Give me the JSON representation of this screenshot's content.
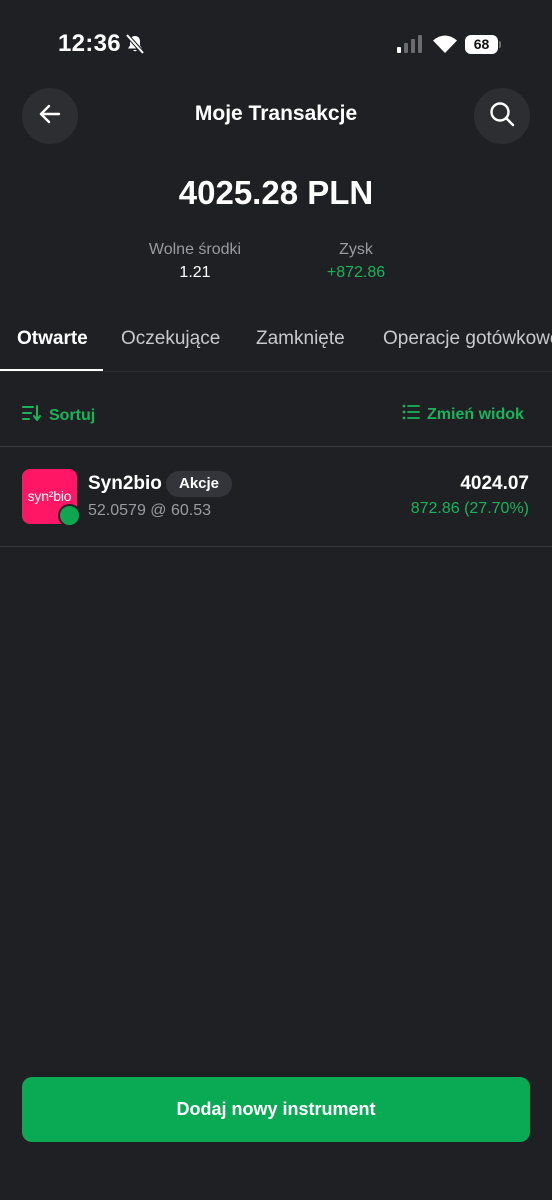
{
  "status_bar": {
    "time": "12:36",
    "battery": "68",
    "icons": [
      "bell-muted-icon",
      "signal-icon",
      "wifi-icon",
      "battery-icon"
    ]
  },
  "header": {
    "title": "Moje Transakcje",
    "back_icon": "arrow-left-icon",
    "search_icon": "search-icon"
  },
  "summary": {
    "total": "4025.28 PLN",
    "free_funds_label": "Wolne środki",
    "free_funds_value": "1.21",
    "profit_label": "Zysk",
    "profit_value": "+872.86"
  },
  "tabs": [
    {
      "label": "Otwarte",
      "active": true
    },
    {
      "label": "Oczekujące",
      "active": false
    },
    {
      "label": "Zamknięte",
      "active": false
    },
    {
      "label": "Operacje gotówkowe",
      "active": false
    }
  ],
  "toolbar": {
    "sort_label": "Sortuj",
    "view_label": "Zmień widok",
    "sort_icon": "sort-icon",
    "view_icon": "list-view-icon"
  },
  "positions": [
    {
      "logo_text": "syn²bio",
      "name": "Syn2bio",
      "badge": "Akcje",
      "details": "52.0579 @ 60.53",
      "value": "4024.07",
      "pl": "872.86 (27.70%)",
      "market_status": "open"
    }
  ],
  "actions": {
    "add_instrument": "Dodaj nowy instrument"
  },
  "colors": {
    "background": "#1f2023",
    "accent_green": "#19b45a",
    "button_green": "#0aa954",
    "logo_pink": "#ff1664",
    "muted_text": "#9a9ba0"
  }
}
